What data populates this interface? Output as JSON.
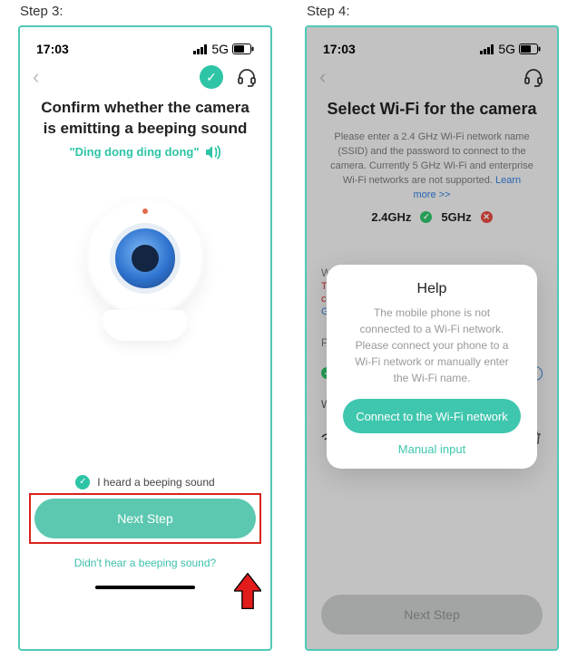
{
  "labels": {
    "step3": "Step 3:",
    "step4": "Step 4:"
  },
  "status": {
    "time": "17:03",
    "network": "5G"
  },
  "colors": {
    "accent": "#2EC4A6",
    "highlight": "#D9221E"
  },
  "step3": {
    "title": "Confirm whether the camera is emitting a beeping sound",
    "sound_phrase": "\"Ding dong ding dong\"",
    "confirm_label": "I heard a beeping sound",
    "next_label": "Next Step",
    "no_sound_label": "Didn't hear a beeping sound?"
  },
  "step4": {
    "title": "Select Wi-Fi for the camera",
    "description": "Please enter a 2.4 GHz Wi-Fi network name (SSID) and the password to connect to the camera. Currently 5 GHz Wi-Fi and enterprise Wi-Fi networks are not supported.",
    "learn_more": "Learn more >>",
    "freq_24": "2.4GHz",
    "freq_5": "5GHz",
    "wifi_field_label": "Wi-Fi",
    "wifi_error_part1": "The r",
    "wifi_error_part2": "conn",
    "wifi_goto": "Go to",
    "password_label": "Password",
    "wifi_section": "Wi-Fi",
    "next_label": "Next Step",
    "modal": {
      "title": "Help",
      "body": "The mobile phone is not connected to a Wi-Fi network. Please connect your phone to a Wi-Fi network or manually enter the Wi-Fi name.",
      "connect_btn": "Connect to the Wi-Fi network",
      "manual_link": "Manual input"
    }
  }
}
